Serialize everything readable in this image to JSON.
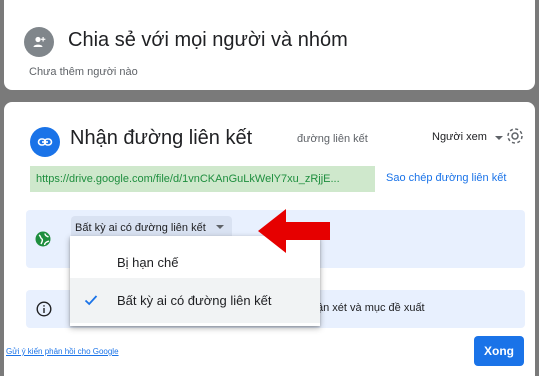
{
  "share_section": {
    "title": "Chia sẻ với mọi người và nhóm",
    "subtitle": "Chưa thêm người nào",
    "icon": "add-person-icon"
  },
  "link_section": {
    "title": "Nhận đường liên kết",
    "icon": "link-icon",
    "settings_icon": "gear-icon",
    "url": "https://drive.google.com/file/d/1vnCKAnGuLkWelY7xu_zRjjE...",
    "copy_label": "Sao chép đường liên kết",
    "access_dropdown_label": "Bất kỳ ai có đường liên kết",
    "access_description_partial": "đường liên kết",
    "role_label": "Người xem",
    "info_text_partial": "ận xét và mục đề xuất"
  },
  "access_menu": {
    "options": [
      {
        "label": "Bị hạn chế",
        "selected": false
      },
      {
        "label": "Bất kỳ ai có đường liên kết",
        "selected": true
      }
    ]
  },
  "footer": {
    "feedback_link": "Gửi ý kiến phản hồi cho Google",
    "done_label": "Xong"
  },
  "colors": {
    "accent": "#1a73e8",
    "url_bg": "#cfe8cc",
    "url_text": "#1e8e3e",
    "overlay": "#7a7a7a",
    "annotation_arrow": "#e00000"
  }
}
